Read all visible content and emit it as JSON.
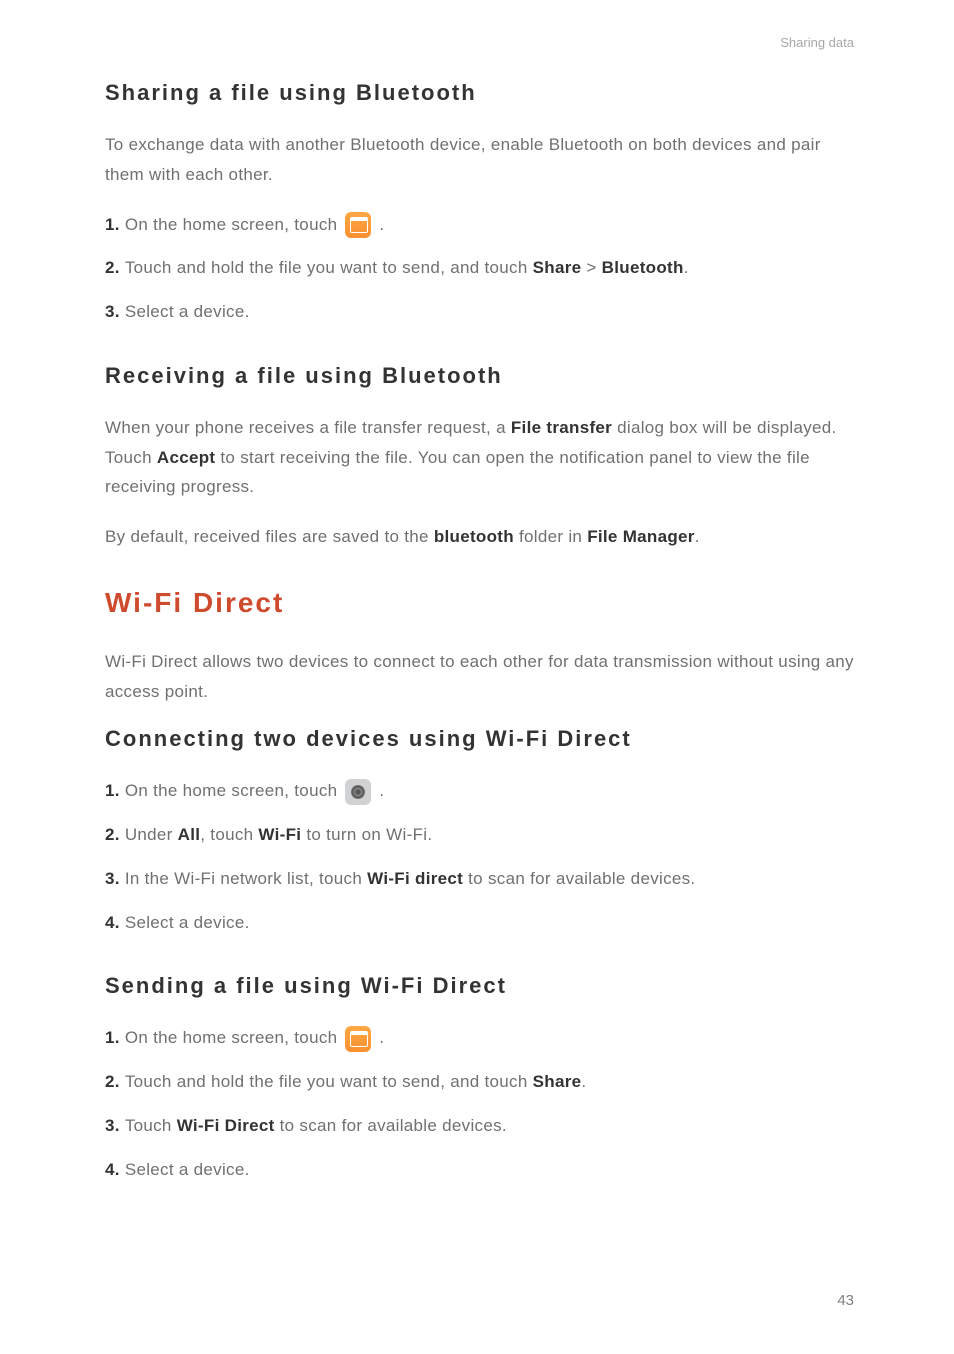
{
  "header": "Sharing data",
  "section_a": {
    "title": "Sharing a file using Bluetooth",
    "intro": "To exchange data with another Bluetooth device, enable Bluetooth on both devices and pair them with each other.",
    "step1_num": "1. ",
    "step1_text": "On the home screen, touch ",
    "step1_end": " .",
    "step2_num": "2. ",
    "step2_text": "Touch and hold the file you want to send, and touch ",
    "step2_share": "Share",
    "step2_gt": " > ",
    "step2_bt": "Bluetooth",
    "step2_end": ".",
    "step3_num": "3. ",
    "step3_text": "Select a device."
  },
  "section_b": {
    "title": "Receiving a file using Bluetooth",
    "para1_a": "When your phone receives a file transfer request, a ",
    "para1_b": "File transfer",
    "para1_c": " dialog box will be displayed. Touch ",
    "para1_d": "Accept",
    "para1_e": " to start receiving the file. You can open the notification panel to view the file receiving progress.",
    "para2_a": "By default, received files are saved to the ",
    "para2_b": "bluetooth",
    "para2_c": " folder in ",
    "para2_d": "File Manager",
    "para2_e": "."
  },
  "wifi": {
    "title": "Wi-Fi Direct",
    "intro": "Wi-Fi Direct allows two devices to connect to each other for data transmission without using any access point."
  },
  "section_c": {
    "title": "Connecting two devices using Wi-Fi Direct",
    "step1_num": "1. ",
    "step1_text": "On the home screen, touch ",
    "step1_end": " .",
    "step2_num": "2. ",
    "step2_a": "Under ",
    "step2_b": "All",
    "step2_c": ", touch ",
    "step2_d": "Wi-Fi",
    "step2_e": " to turn on Wi-Fi.",
    "step3_num": "3. ",
    "step3_a": "In the Wi-Fi network list, touch ",
    "step3_b": "Wi-Fi direct",
    "step3_c": " to scan for available devices.",
    "step4_num": "4. ",
    "step4_text": "Select a device."
  },
  "section_d": {
    "title": "Sending a file using Wi-Fi Direct",
    "step1_num": "1. ",
    "step1_text": "On the home screen, touch ",
    "step1_end": " .",
    "step2_num": "2. ",
    "step2_a": "Touch and hold the file you want to send, and touch ",
    "step2_b": "Share",
    "step2_c": ".",
    "step3_num": "3. ",
    "step3_a": "Touch ",
    "step3_b": "Wi-Fi Direct",
    "step3_c": " to scan for available devices.",
    "step4_num": "4. ",
    "step4_text": "Select a device."
  },
  "page_number": "43"
}
